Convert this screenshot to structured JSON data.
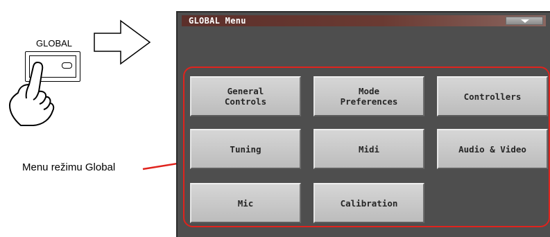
{
  "illustration": {
    "hardware_button_label": "GLOBAL",
    "caption": "Menu režimu Global"
  },
  "screen": {
    "title": "GLOBAL Menu",
    "buttons": [
      {
        "label": "General\nControls"
      },
      {
        "label": "Mode\nPreferences"
      },
      {
        "label": "Controllers"
      },
      {
        "label": "Tuning"
      },
      {
        "label": "Midi"
      },
      {
        "label": "Audio & Video"
      },
      {
        "label": "Mic"
      },
      {
        "label": "Calibration"
      }
    ]
  },
  "colors": {
    "highlight_red": "#e0231d",
    "screen_bg": "#4e4e4e",
    "titlebar": "#5c2f2a",
    "button_face": "#c8c8c8"
  }
}
